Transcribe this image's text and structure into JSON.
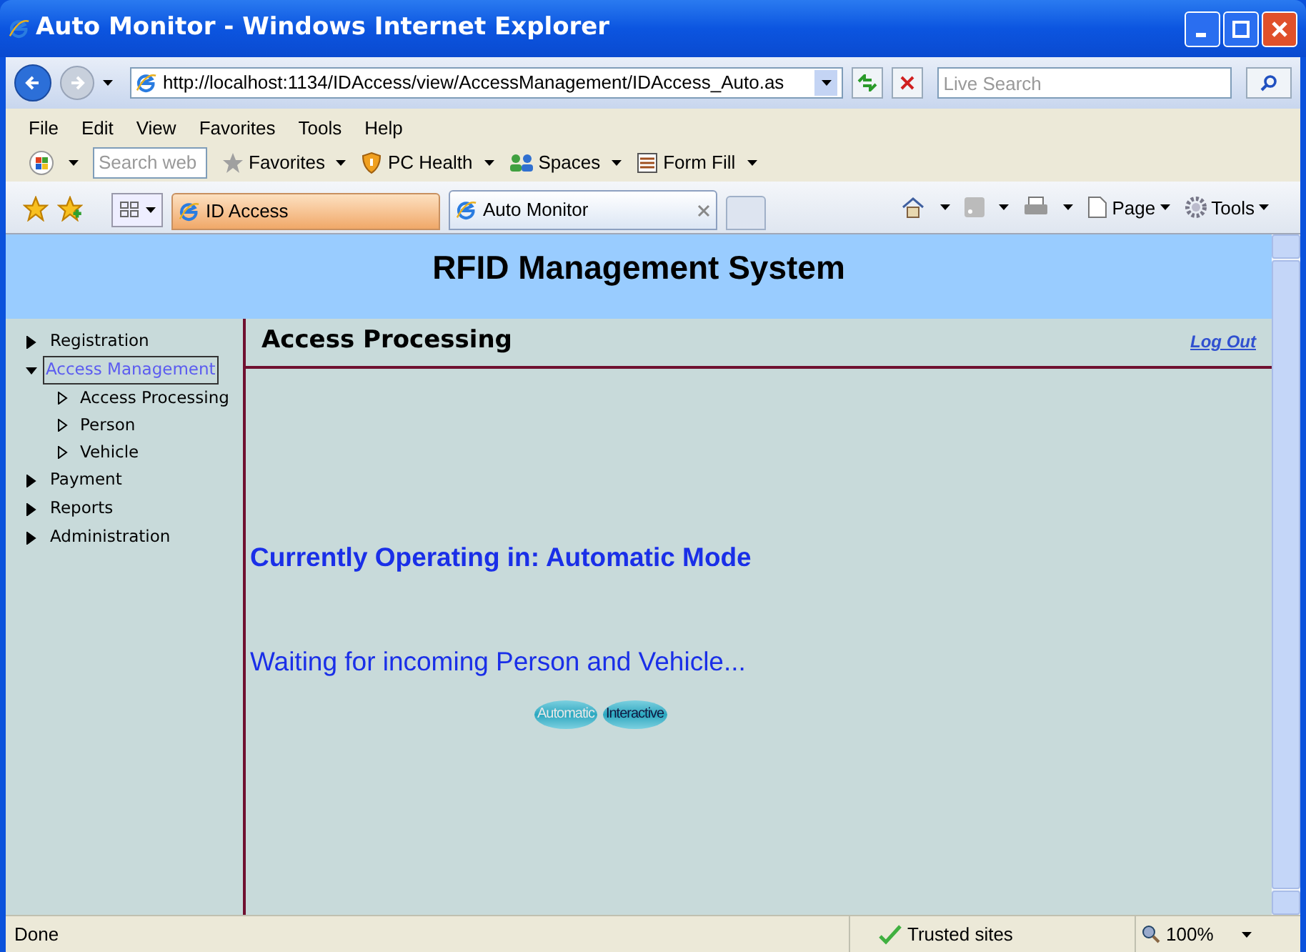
{
  "window": {
    "title": "Auto Monitor - Windows Internet Explorer"
  },
  "address_bar": {
    "url": "http://localhost:1134/IDAccess/view/AccessManagement/IDAccess_Auto.as"
  },
  "search": {
    "placeholder": "Live Search"
  },
  "menu": [
    "File",
    "Edit",
    "View",
    "Favorites",
    "Tools",
    "Help"
  ],
  "toolbar": {
    "search_placeholder": "Search web",
    "items": [
      "Favorites",
      "PC Health",
      "Spaces",
      "Form Fill"
    ]
  },
  "tabs": [
    {
      "label": "ID Access",
      "selected": false
    },
    {
      "label": "Auto Monitor",
      "selected": true
    }
  ],
  "command_bar": [
    "Page",
    "Tools"
  ],
  "page": {
    "site_title": "RFID Management System",
    "nav": [
      {
        "label": "Registration",
        "expanded": false,
        "selected": false
      },
      {
        "label": "Access Management",
        "expanded": true,
        "selected": true,
        "children": [
          {
            "label": "Access Processing",
            "expanded": false,
            "selected": false
          },
          {
            "label": "Person",
            "expanded": false,
            "selected": false
          },
          {
            "label": "Vehicle",
            "expanded": false,
            "selected": false
          }
        ]
      },
      {
        "label": "Payment",
        "expanded": false,
        "selected": false
      },
      {
        "label": "Reports",
        "expanded": false,
        "selected": false
      },
      {
        "label": "Administration",
        "expanded": false,
        "selected": false
      }
    ],
    "heading": "Access Processing",
    "logout": "Log Out",
    "mode_text": "Currently Operating in: Automatic Mode",
    "status_text": "Waiting for incoming Person and Vehicle...",
    "mode_buttons": [
      {
        "label": "Automatic",
        "selected": true
      },
      {
        "label": "Interactive",
        "selected": false
      }
    ]
  },
  "status_bar": {
    "text": "Done",
    "zone": "Trusted sites",
    "zoom": "100%"
  }
}
